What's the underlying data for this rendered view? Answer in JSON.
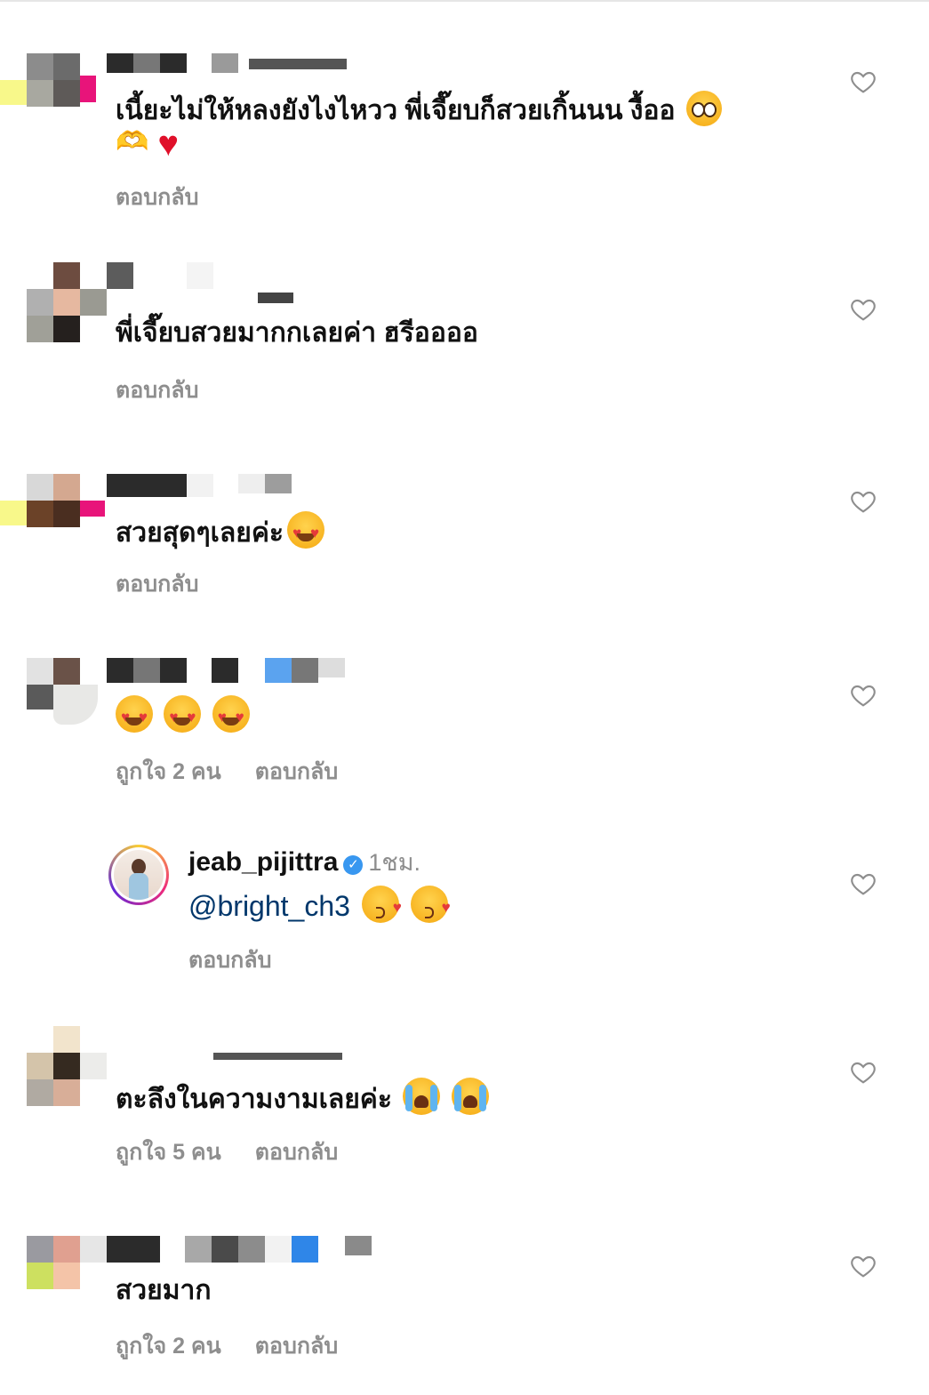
{
  "ui": {
    "reply_label": "ตอบกลับ"
  },
  "comments": [
    {
      "text": "เนี้ยะไม่ให้หลงยังไงไหวว พี่เจี๊ยบก็สวยเกิ้นนน งื้ออ",
      "likes": ""
    },
    {
      "text": "พี่เจี๊ยบสวยมากกเลยค่า ฮรีออออ",
      "likes": ""
    },
    {
      "text": "สวยสุดๆเลยค่ะ",
      "likes": ""
    },
    {
      "text": "",
      "likes": "ถูกใจ 2 คน"
    },
    {
      "username": "jeab_pijittra",
      "time": "1ชม.",
      "mention": "@bright_ch3",
      "likes": ""
    },
    {
      "text": "ตะลึงในความงามเลยค่ะ",
      "likes": "ถูกใจ 5 คน"
    },
    {
      "text": "สวยมาก",
      "likes": "ถูกใจ 2 คน"
    }
  ],
  "icons": {
    "heart": "heart-outline-icon",
    "verified": "verified-badge-icon"
  },
  "colors": {
    "meta": "#8e8e8e",
    "mention": "#00376b",
    "verified": "#3897f0"
  }
}
